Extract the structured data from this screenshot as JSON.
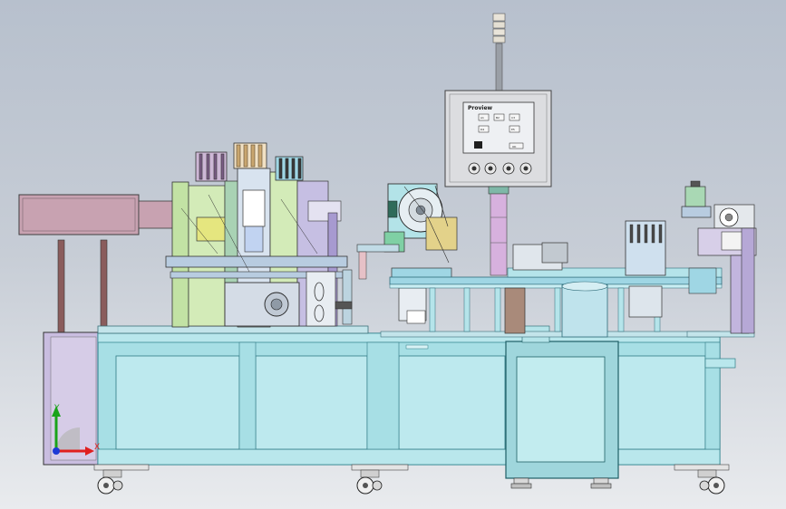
{
  "hmi": {
    "brand": "Proview",
    "buttons": [
      "A1",
      "B2",
      "C3",
      "D4",
      "E5"
    ],
    "confirm_label": "OK"
  },
  "triad": {
    "x_label": "X",
    "y_label": "Y"
  },
  "colors": {
    "frame": "#a7dfe5",
    "frame_stroke": "#3a8a95",
    "guard": "#b2a4c9",
    "column_green": "#c2e2a4",
    "conveyor": "#9fd6e4",
    "panel": "#dcdde0",
    "wire": "#2e2e2e"
  }
}
